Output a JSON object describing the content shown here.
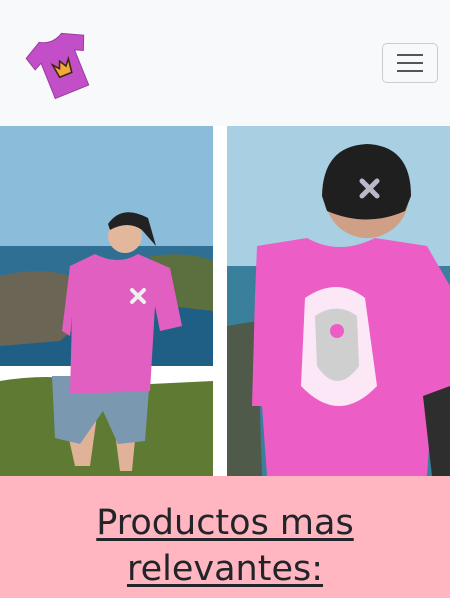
{
  "navbar": {
    "logo_icon": "pink-tshirt-crown-logo",
    "toggler_icon": "hamburger-menu-icon"
  },
  "gallery": {
    "images": [
      {
        "name": "model-pink-tshirt-front"
      },
      {
        "name": "model-pink-tshirt-back"
      }
    ]
  },
  "relevant_section": {
    "title": "Productos mas relevantes:",
    "background": "#ffb6c1"
  }
}
